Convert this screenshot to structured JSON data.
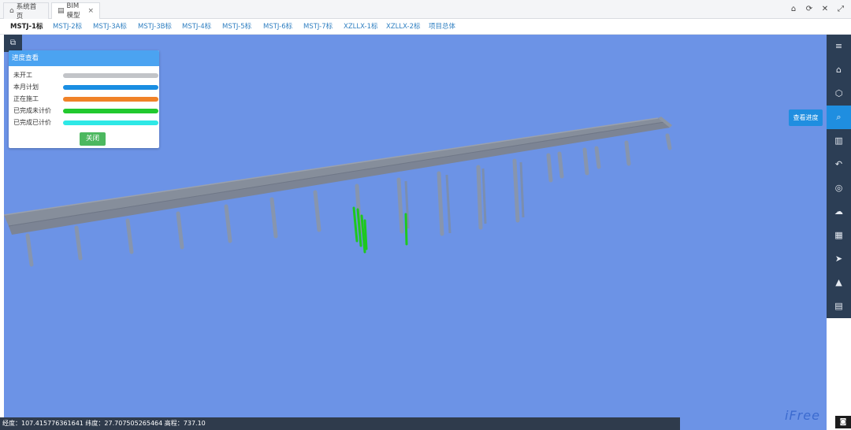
{
  "top_tabs": [
    {
      "icon": "home-icon",
      "label": "系统首页"
    },
    {
      "icon": "document-icon",
      "label": "BIM模型",
      "close": "×"
    }
  ],
  "window_controls": [
    {
      "name": "home-icon",
      "glyph": "⌂"
    },
    {
      "name": "refresh-icon",
      "glyph": "⟳"
    },
    {
      "name": "close-icon",
      "glyph": "✕"
    },
    {
      "name": "fullscreen-icon",
      "glyph": "⤢"
    }
  ],
  "sub_tabs": [
    "MSTJ-1标",
    "MSTJ-2标",
    "MSTJ-3A标",
    "MSTJ-3B标",
    "MSTJ-4标",
    "MSTJ-5标",
    "MSTJ-6标",
    "MSTJ-7标",
    "XZLLX-1标",
    "XZLLX-2标",
    "项目总体"
  ],
  "active_sub_tab": "MSTJ-1标",
  "panel": {
    "title": "进度查看",
    "legend": [
      {
        "label": "未开工",
        "color": "#c2c4c8"
      },
      {
        "label": "本月计划",
        "color": "#1a8ee2"
      },
      {
        "label": "正在施工",
        "color": "#f08228"
      },
      {
        "label": "已完成未计价",
        "color": "#22c92e"
      },
      {
        "label": "已完成已计价",
        "color": "#2ee8e6"
      }
    ],
    "close_label": "关闭"
  },
  "right_toolbar": [
    {
      "name": "menu-icon",
      "glyph": "≡"
    },
    {
      "name": "home-icon",
      "glyph": "⌂"
    },
    {
      "name": "cube-icon",
      "glyph": "⬡"
    },
    {
      "name": "search-icon",
      "glyph": "⌕"
    },
    {
      "name": "bar-chart-icon",
      "glyph": "▥"
    },
    {
      "name": "undo-icon",
      "glyph": "↶"
    },
    {
      "name": "eye-off-icon",
      "glyph": "◎"
    },
    {
      "name": "cloud-icon",
      "glyph": "☁"
    },
    {
      "name": "map-icon",
      "glyph": "▦"
    },
    {
      "name": "navigation-icon",
      "glyph": "➤"
    },
    {
      "name": "warning-icon",
      "glyph": "▲"
    },
    {
      "name": "save-icon",
      "glyph": "▤"
    }
  ],
  "tooltip": "查看进度",
  "status": "经度：107.415776361641 纬度：27.707505265464 高程：737.10",
  "brand": "iFree",
  "colors": {
    "sky": "#6c93e6",
    "toolbar": "#2c3e55",
    "accent": "#1f8ee0",
    "pier_done": "#1ec81e"
  }
}
